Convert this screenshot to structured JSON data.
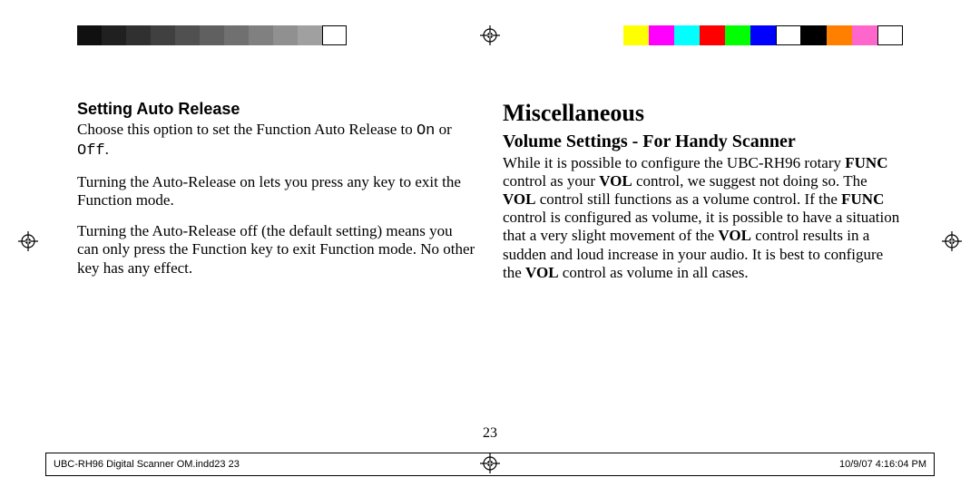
{
  "grayscale_bar": [
    "#101010",
    "#202020",
    "#303030",
    "#404040",
    "#505050",
    "#606060",
    "#707070",
    "#808080",
    "#909090",
    "#a0a0a0",
    "#ffffff"
  ],
  "color_bar": [
    "#ffff00",
    "#ff00ff",
    "#00ffff",
    "#ff0000",
    "#00ff00",
    "#0000ff",
    "#ffffff",
    "#000000",
    "#ff8000",
    "#ff66cc",
    "#ffffff"
  ],
  "left": {
    "heading": "Setting Auto Release",
    "p1a": "Choose this option to set the Function Auto Release to ",
    "p1_on": "On",
    "p1_mid": " or ",
    "p1_off": "Off",
    "p1b": ".",
    "p2": "Turning the Auto-Release on lets you press any key to exit the Function mode.",
    "p3": "Turning the Auto-Release off (the default setting) means you can only press the Function key to exit Function mode. No other key has any effect."
  },
  "right": {
    "h1": "Miscellaneous",
    "h2": "Volume Settings - For Handy Scanner",
    "p_a": "While it is possible to configure the UBC-RH96 rotary ",
    "p_b": " control as your ",
    "p_c": " control, we suggest not doing so. The ",
    "p_d": " control still functions as a volume control. If the ",
    "p_e": " control is configured as volume, it is possible to have a situation that a very slight movement of the ",
    "p_f": " control results in a sudden and loud increase in your audio. It is best to configure the ",
    "p_g": " control as volume in all cases.",
    "FUNC": "FUNC",
    "VOL": "VOL"
  },
  "page_number": "23",
  "footer_left": "UBC-RH96 Digital Scanner OM.indd23   23",
  "footer_right": "10/9/07   4:16:04 PM"
}
